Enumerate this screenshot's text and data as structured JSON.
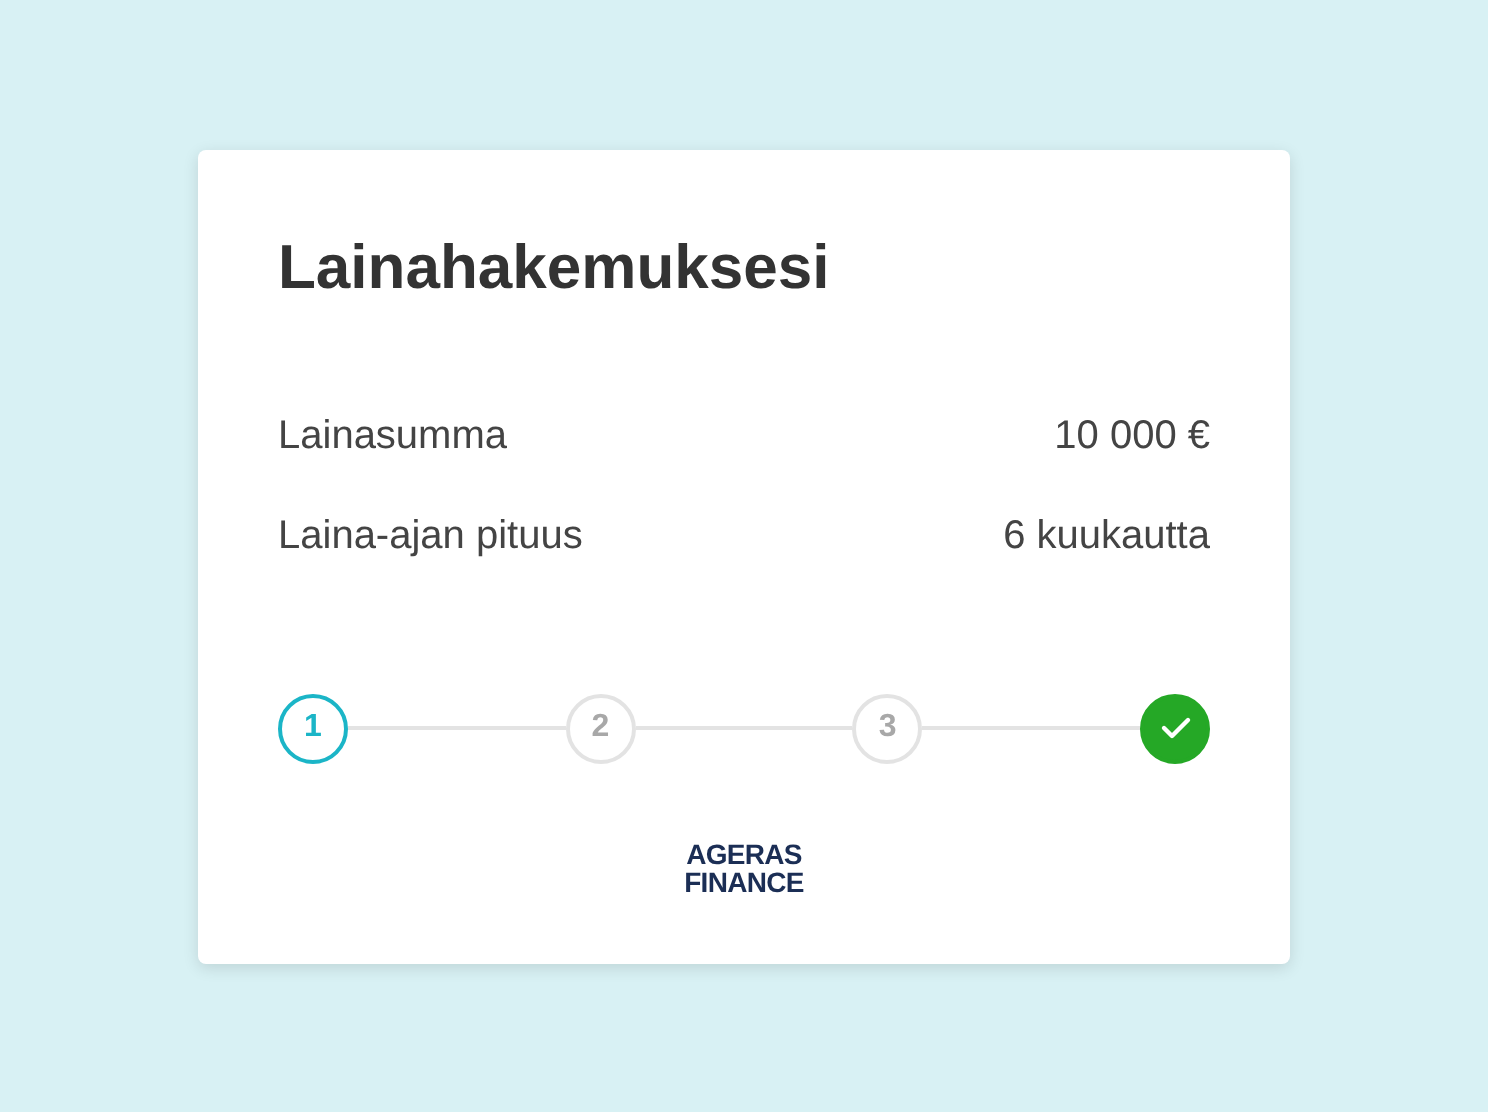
{
  "title": "Lainahakemuksesi",
  "details": [
    {
      "label": "Lainasumma",
      "value": "10 000 €"
    },
    {
      "label": "Laina-ajan pituus",
      "value": "6 kuukautta"
    }
  ],
  "steps": [
    {
      "kind": "number",
      "label": "1",
      "selected": true,
      "completed": false
    },
    {
      "kind": "number",
      "label": "2",
      "selected": false,
      "completed": false
    },
    {
      "kind": "number",
      "label": "3",
      "selected": false,
      "completed": false
    },
    {
      "kind": "check",
      "selected": false,
      "completed": true
    }
  ],
  "logo": [
    "AGERAS",
    "FINANCE"
  ]
}
